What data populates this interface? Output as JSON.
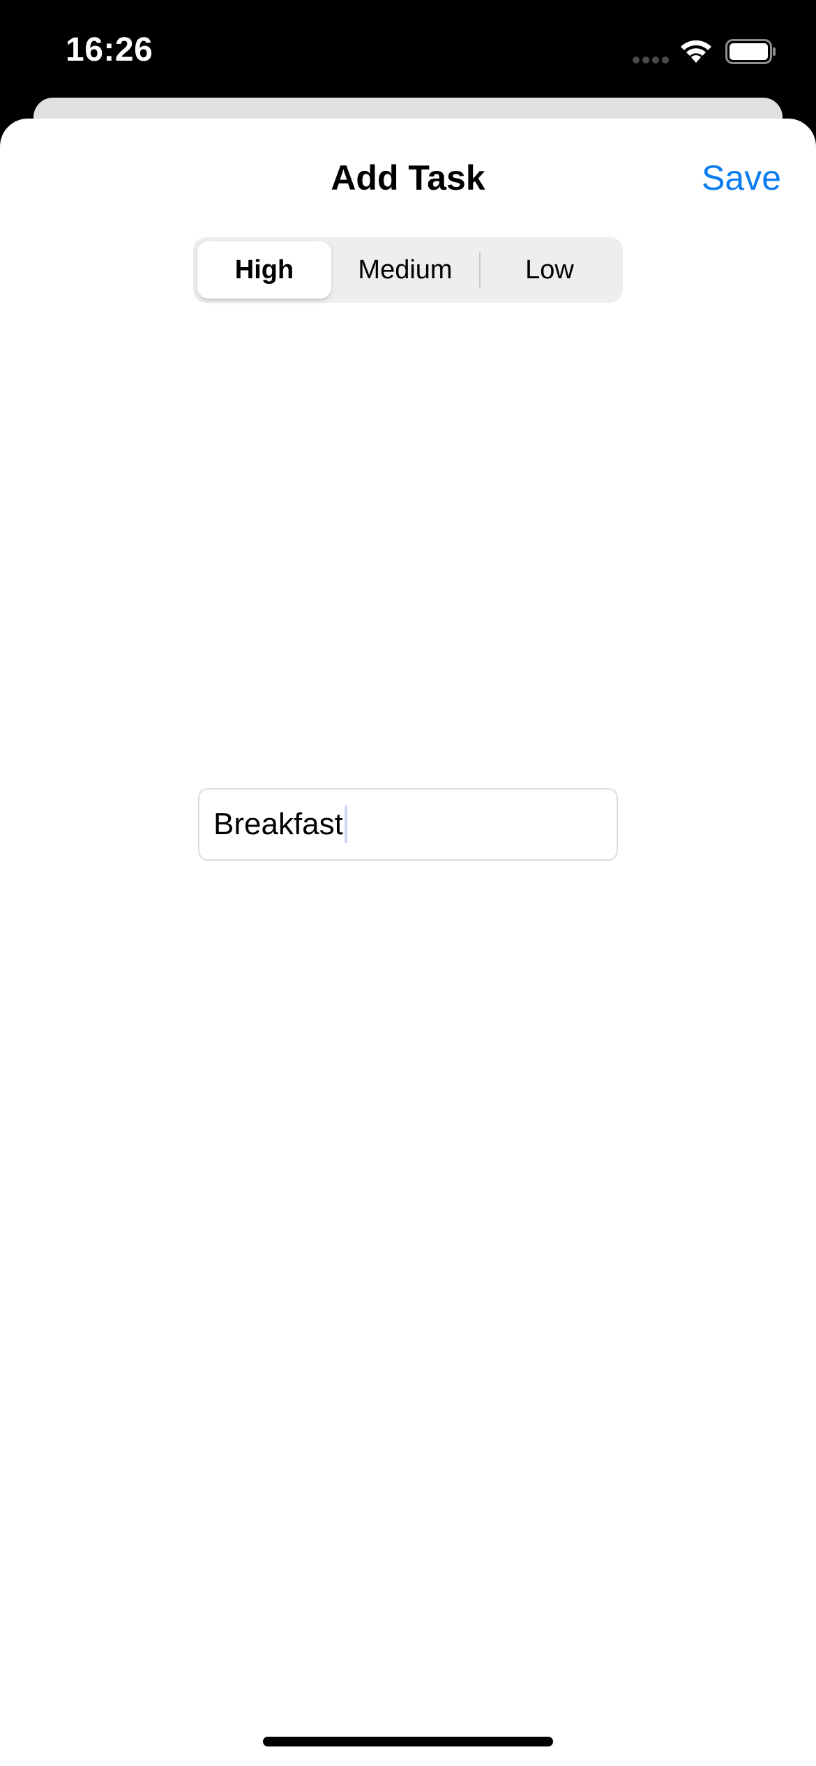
{
  "status_bar": {
    "time": "16:26",
    "icons": [
      "cellular-signal-icon",
      "wifi-icon",
      "battery-icon"
    ]
  },
  "sheet": {
    "title": "Add Task",
    "save_label": "Save"
  },
  "priority_control": {
    "segments": [
      {
        "label": "High",
        "selected": true
      },
      {
        "label": "Medium",
        "selected": false
      },
      {
        "label": "Low",
        "selected": false
      }
    ]
  },
  "task_field": {
    "value": "Breakfast"
  },
  "colors": {
    "accent": "#0a7cf0",
    "sheet_background": "#ffffff",
    "screen_background": "#000000",
    "segmented_background": "#eeeeef"
  }
}
